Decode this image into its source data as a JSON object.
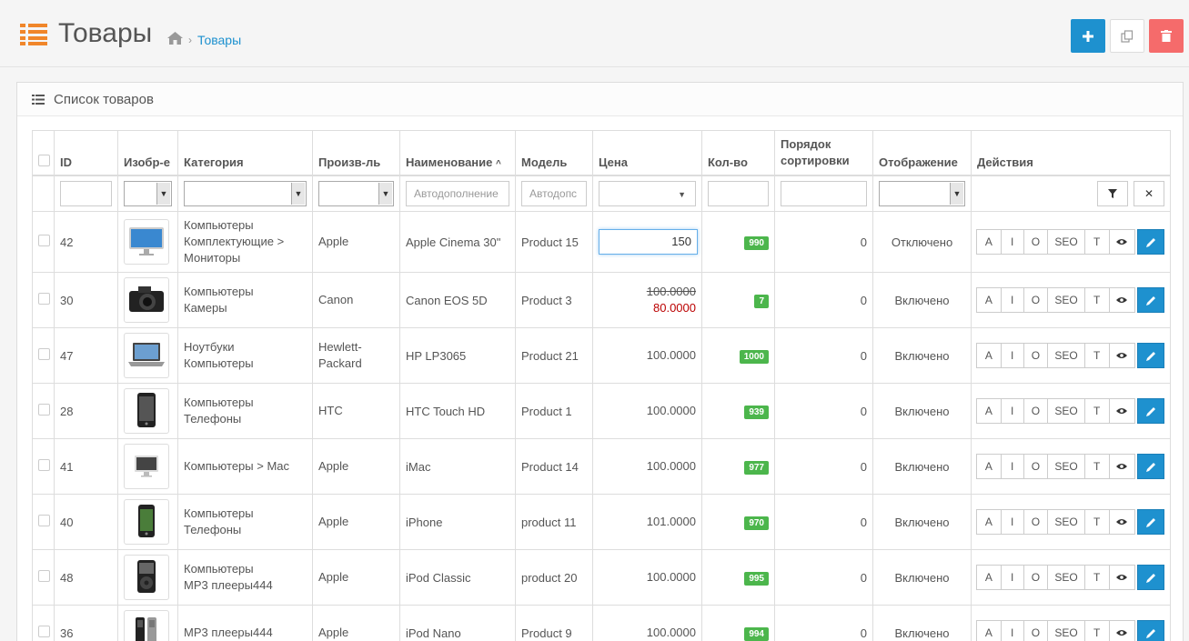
{
  "header": {
    "title": "Товары",
    "breadcrumb_current": "Товары",
    "add_icon": "plus-icon",
    "copy_icon": "copy-icon",
    "delete_icon": "trash-icon"
  },
  "panel": {
    "title": "Список товаров"
  },
  "columns": {
    "id": "ID",
    "image": "Изобр-е",
    "category": "Категория",
    "manufacturer": "Произв-ль",
    "name": "Наименование",
    "model": "Модель",
    "price": "Цена",
    "quantity": "Кол-во",
    "sort_order": "Порядок сортировки",
    "status": "Отображение",
    "actions": "Действия"
  },
  "filters": {
    "name_placeholder": "Автодополнение",
    "model_placeholder": "Автодопс"
  },
  "action_labels": {
    "a": "A",
    "i": "I",
    "o": "O",
    "seo": "SEO",
    "t": "T"
  },
  "rows": [
    {
      "id": "42",
      "image": "monitor",
      "category_lines": [
        "Компьютеры",
        "Комплектующие >",
        "Мониторы"
      ],
      "manufacturer_lines": [
        "Apple"
      ],
      "name": "Apple Cinema 30\"",
      "model": "Product 15",
      "price_edit": "150",
      "quantity": "990",
      "sort": "0",
      "status": "Отключено"
    },
    {
      "id": "30",
      "image": "camera",
      "category_lines": [
        "Компьютеры",
        "Камеры"
      ],
      "manufacturer_lines": [
        "Canon"
      ],
      "name": "Canon EOS 5D",
      "model": "Product 3",
      "price_old": "100.0000",
      "price_special": "80.0000",
      "quantity": "7",
      "sort": "0",
      "status": "Включено"
    },
    {
      "id": "47",
      "image": "laptop",
      "category_lines": [
        "Ноутбуки",
        "Компьютеры"
      ],
      "manufacturer_lines": [
        "Hewlett-",
        "Packard"
      ],
      "name": "HP LP3065",
      "model": "Product 21",
      "price": "100.0000",
      "quantity": "1000",
      "sort": "0",
      "status": "Включено"
    },
    {
      "id": "28",
      "image": "phone",
      "category_lines": [
        "Компьютеры",
        "Телефоны"
      ],
      "manufacturer_lines": [
        "HTC"
      ],
      "name": "HTC Touch HD",
      "model": "Product 1",
      "price": "100.0000",
      "quantity": "939",
      "sort": "0",
      "status": "Включено"
    },
    {
      "id": "41",
      "image": "imac",
      "category_lines": [
        "Компьютеры > Mac"
      ],
      "manufacturer_lines": [
        "Apple"
      ],
      "name": "iMac",
      "model": "Product 14",
      "price": "100.0000",
      "quantity": "977",
      "sort": "0",
      "status": "Включено"
    },
    {
      "id": "40",
      "image": "iphone",
      "category_lines": [
        "Компьютеры",
        "Телефоны"
      ],
      "manufacturer_lines": [
        "Apple"
      ],
      "name": "iPhone",
      "model": "product 11",
      "price": "101.0000",
      "quantity": "970",
      "sort": "0",
      "status": "Включено"
    },
    {
      "id": "48",
      "image": "ipod",
      "category_lines": [
        "Компьютеры",
        "MP3 плееры444"
      ],
      "manufacturer_lines": [
        "Apple"
      ],
      "name": "iPod Classic",
      "model": "product 20",
      "price": "100.0000",
      "quantity": "995",
      "sort": "0",
      "status": "Включено"
    },
    {
      "id": "36",
      "image": "ipodnano",
      "category_lines": [
        "MP3 плееры444"
      ],
      "manufacturer_lines": [
        "Apple"
      ],
      "name": "iPod Nano",
      "model": "Product 9",
      "price": "100.0000",
      "quantity": "994",
      "sort": "0",
      "status": "Включено"
    }
  ],
  "colors": {
    "accent": "#1e91cf",
    "danger": "#f56b6b",
    "success": "#4cb64c",
    "title_icon": "#f0862a"
  }
}
